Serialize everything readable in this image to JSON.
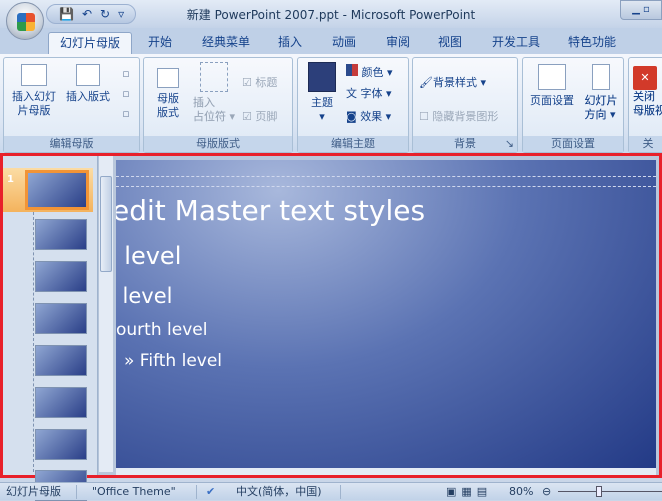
{
  "window": {
    "title": "新建 PowerPoint 2007.ppt - Microsoft PowerPoint"
  },
  "qat": {
    "save": "💾",
    "undo": "↶",
    "redo": "↻",
    "more": "▿"
  },
  "tabs": [
    "幻灯片母版",
    "开始",
    "经典菜单",
    "插入",
    "动画",
    "审阅",
    "视图",
    "开发工具",
    "特色功能"
  ],
  "ribbon": {
    "groups": [
      {
        "label": "编辑母版",
        "buttons": [
          "插入幻灯片母版",
          "插入版式"
        ]
      },
      {
        "label": "母版版式",
        "buttons": [
          "母版版式",
          "插入占位符",
          "标题",
          "页脚"
        ]
      },
      {
        "label": "编辑主题",
        "buttons": [
          "主题",
          "颜色",
          "字体",
          "效果"
        ]
      },
      {
        "label": "背景",
        "buttons": [
          "背景样式",
          "隐藏背景图形"
        ]
      },
      {
        "label": "页面设置",
        "buttons": [
          "页面设置",
          "幻灯片方向"
        ]
      },
      {
        "label": "关闭",
        "buttons": [
          "关闭母版视图"
        ]
      }
    ],
    "b_insert_master_1": "插入幻灯",
    "b_insert_master_2": "片母版",
    "b_insert_layout": "插入版式",
    "b_master_layout_1": "母版",
    "b_master_layout_2": "版式",
    "b_placeholder_1": "插入",
    "b_placeholder_2": "占位符 ▾",
    "chk_title": "标题",
    "chk_footer": "页脚",
    "b_theme": "主题",
    "b_colors": "颜色 ▾",
    "b_fonts": "字体 ▾",
    "b_effects": "效果 ▾",
    "b_bg_styles": "背景样式 ▾",
    "chk_hide_bg": "隐藏背景图形",
    "b_page_setup": "页面设置",
    "b_orient_1": "幻灯片",
    "b_orient_2": "方向 ▾",
    "b_close_1": "关闭",
    "b_close_2": "母版视"
  },
  "thumbs": {
    "selected_number": "1",
    "count": 8
  },
  "slide": {
    "title": "edit Master text styles",
    "levels": [
      "l level",
      "l level",
      "ourth level",
      "» Fifth level"
    ]
  },
  "status": {
    "view": "幻灯片母版",
    "theme": "\"Office Theme\"",
    "language": "中文(简体，中国)",
    "zoom": "80%",
    "zoom_percent": 80
  }
}
